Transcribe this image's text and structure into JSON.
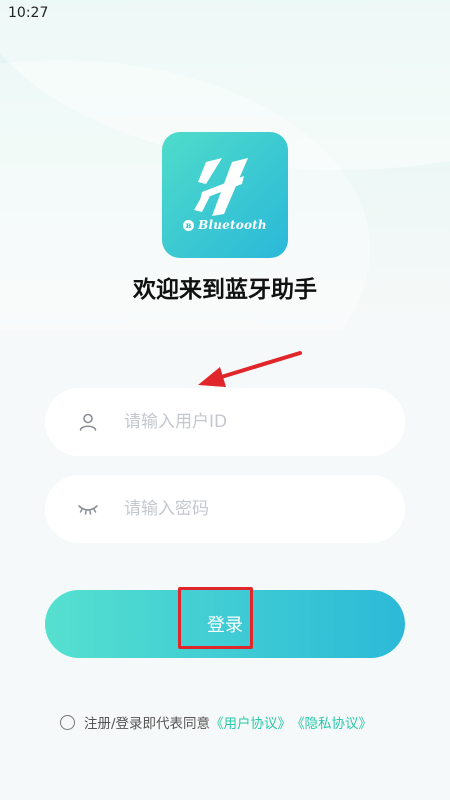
{
  "status_bar": {
    "time": "10:27"
  },
  "logo": {
    "brand_text": "Bluetooth",
    "bt_symbol": "ʙ"
  },
  "welcome": {
    "title": "欢迎来到蓝牙助手"
  },
  "form": {
    "user_id": {
      "value": "",
      "placeholder": "请输入用户ID",
      "icon": "user-icon"
    },
    "password": {
      "value": "",
      "placeholder": "请输入密码",
      "icon": "eye-closed-icon"
    },
    "login_label": "登录"
  },
  "agreement": {
    "prefix": "注册/登录即代表同意",
    "user_agreement": "《用户协议》",
    "privacy_policy": "《隐私协议》"
  },
  "colors": {
    "accent_start": "#55e0cf",
    "accent_end": "#2bb9d8",
    "link": "#2cc9a8",
    "annotation": "#e0262a"
  }
}
